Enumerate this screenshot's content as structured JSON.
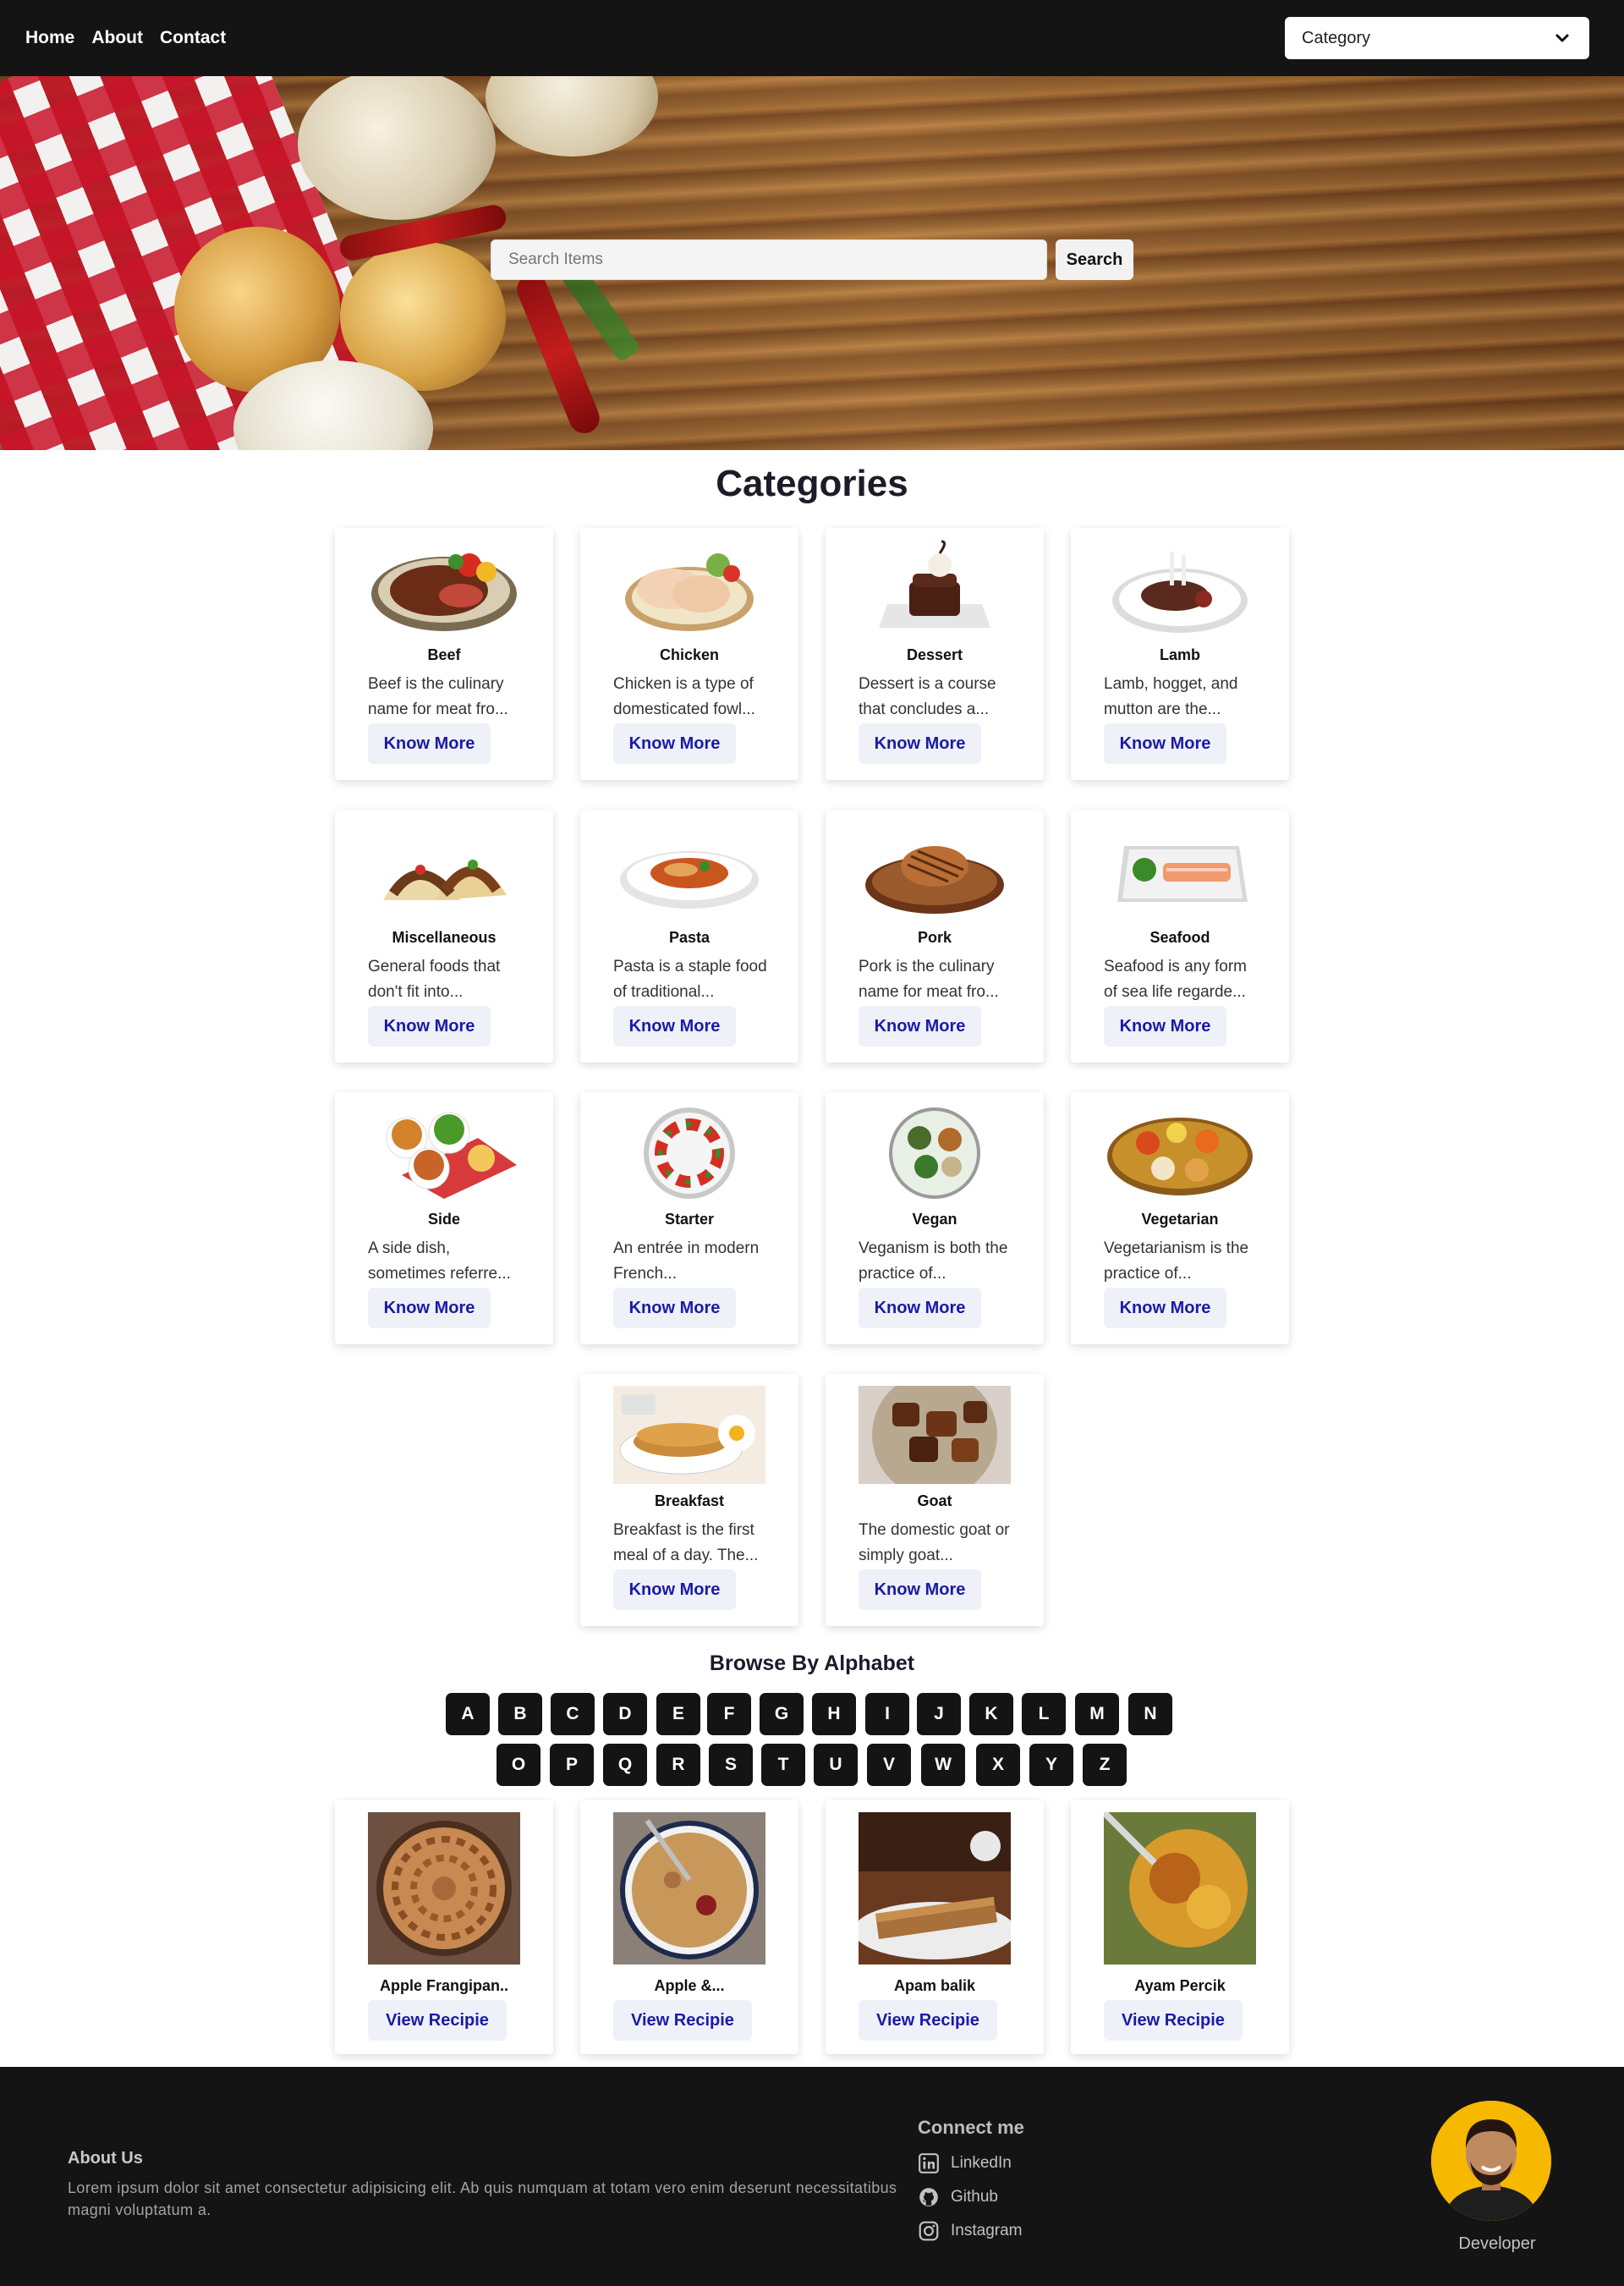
{
  "nav": {
    "links": [
      "Home",
      "About",
      "Contact"
    ],
    "category_select": "Category"
  },
  "hero": {
    "search_placeholder": "Search Items",
    "search_button": "Search"
  },
  "categories": {
    "title": "Categories",
    "button_label": "Know More",
    "items": [
      {
        "name": "Beef",
        "desc": "Beef is the culinary name for meat fro...",
        "icon": "beef-steak-image"
      },
      {
        "name": "Chicken",
        "desc": "Chicken is a type of domesticated fowl...",
        "icon": "chicken-image"
      },
      {
        "name": "Dessert",
        "desc": "Dessert is a course that concludes a...",
        "icon": "dessert-image"
      },
      {
        "name": "Lamb",
        "desc": "Lamb, hogget, and mutton are the...",
        "icon": "lamb-image"
      },
      {
        "name": "Miscellaneous",
        "desc": "General foods that don't fit into...",
        "icon": "tacos-image"
      },
      {
        "name": "Pasta",
        "desc": "Pasta is a staple food of traditional...",
        "icon": "pasta-image"
      },
      {
        "name": "Pork",
        "desc": "Pork is the culinary name for meat fro...",
        "icon": "pork-image"
      },
      {
        "name": "Seafood",
        "desc": "Seafood is any form of sea life regarde...",
        "icon": "seafood-image"
      },
      {
        "name": "Side",
        "desc": "A side dish, sometimes referre...",
        "icon": "side-dish-image"
      },
      {
        "name": "Starter",
        "desc": "An entrée in modern French...",
        "icon": "starter-image"
      },
      {
        "name": "Vegan",
        "desc": "Veganism is both the practice of...",
        "icon": "vegan-image"
      },
      {
        "name": "Vegetarian",
        "desc": "Vegetarianism is the practice of...",
        "icon": "vegetarian-image"
      },
      {
        "name": "Breakfast",
        "desc": "Breakfast is the first meal of a day. The...",
        "icon": "breakfast-image"
      },
      {
        "name": "Goat",
        "desc": "The domestic goat or simply goat...",
        "icon": "goat-image"
      }
    ]
  },
  "browse": {
    "title": "Browse By Alphabet",
    "row1": [
      "A",
      "B",
      "C",
      "D",
      "E",
      "F",
      "G",
      "H",
      "I",
      "J",
      "K",
      "L",
      "M",
      "N"
    ],
    "row2": [
      "O",
      "P",
      "Q",
      "R",
      "S",
      "T",
      "U",
      "V",
      "W",
      "X",
      "Y",
      "Z"
    ]
  },
  "recipes": {
    "button_label": "View Recipie",
    "items": [
      {
        "name": "Apple Frangipan..",
        "icon": "apple-frangipan-tart-image"
      },
      {
        "name": "Apple &...",
        "icon": "apple-crumble-image"
      },
      {
        "name": "Apam balik",
        "icon": "apam-balik-image"
      },
      {
        "name": "Ayam Percik",
        "icon": "ayam-percik-image"
      }
    ]
  },
  "footer": {
    "about_title": "About Us",
    "about_text": "Lorem ipsum dolor sit amet consectetur adipisicing elit. Ab quis numquam at totam vero enim deserunt necessitatibus magni voluptatum a.",
    "connect_title": "Connect me",
    "socials": [
      "LinkedIn",
      "Github",
      "Instagram"
    ],
    "developer_label": "Developer"
  }
}
